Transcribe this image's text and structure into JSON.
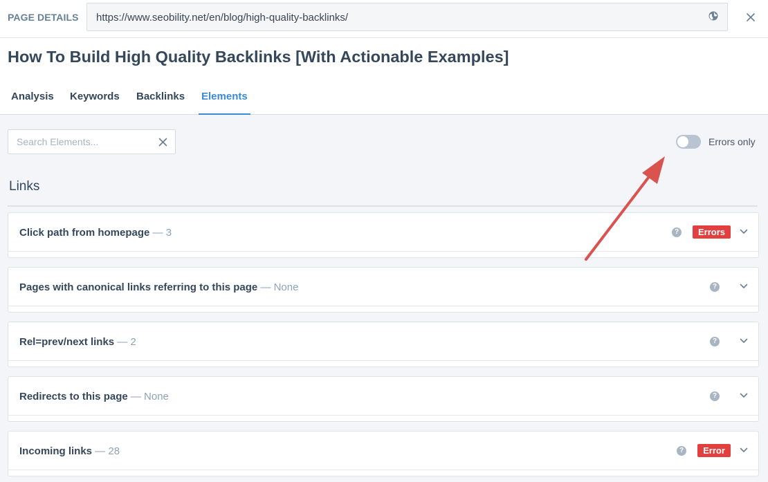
{
  "topbar": {
    "label": "PAGE DETAILS",
    "url": "https://www.seobility.net/en/blog/high-quality-backlinks/"
  },
  "page_title": "How To Build High Quality Backlinks [With Actionable Examples]",
  "tabs": [
    {
      "label": "Analysis"
    },
    {
      "label": "Keywords"
    },
    {
      "label": "Backlinks"
    },
    {
      "label": "Elements",
      "active": true
    }
  ],
  "search": {
    "placeholder": "Search Elements..."
  },
  "errors_toggle": {
    "label": "Errors only",
    "on": false
  },
  "section": {
    "title": "Links"
  },
  "cards": [
    {
      "title": "Click path from homepage",
      "count": " — 3",
      "badge": "Errors"
    },
    {
      "title": "Pages with canonical links referring to this page",
      "count": " — None",
      "badge": ""
    },
    {
      "title": "Rel=prev/next links",
      "count": " — 2",
      "badge": ""
    },
    {
      "title": "Redirects to this page",
      "count": " — None",
      "badge": ""
    },
    {
      "title": "Incoming links",
      "count": " — 28",
      "badge": "Error"
    }
  ],
  "colors": {
    "accent": "#3a8ad6",
    "error": "#e2403f",
    "annotation_arrow": "#d9534f"
  },
  "icons": [
    "globe-icon",
    "close-icon",
    "clear-search-icon",
    "help-icon",
    "chevron-down-icon"
  ]
}
